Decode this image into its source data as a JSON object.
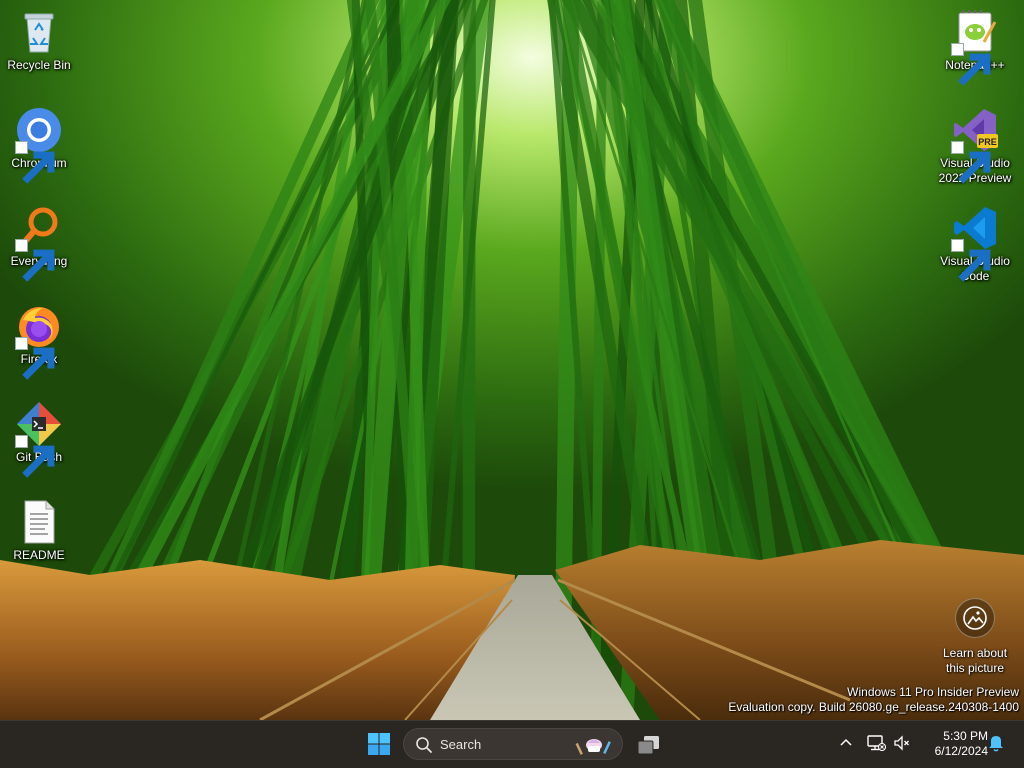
{
  "desktop": {
    "left_icons": [
      {
        "label": "Recycle Bin",
        "icon": "recycle-bin-icon"
      },
      {
        "label": "Chromium",
        "icon": "chromium-icon"
      },
      {
        "label": "Everything",
        "icon": "everything-search-icon"
      },
      {
        "label": "Firefox",
        "icon": "firefox-icon"
      },
      {
        "label": "Git Bash",
        "icon": "git-bash-icon"
      },
      {
        "label": "README",
        "icon": "text-document-icon"
      }
    ],
    "right_icons": [
      {
        "label": "Notepad++",
        "icon": "notepad-plus-plus-icon"
      },
      {
        "label": "Visual Studio 2022 Preview",
        "badge": "PRE",
        "icon": "visual-studio-preview-icon"
      },
      {
        "label": "Visual Studio Code",
        "icon": "vscode-icon"
      }
    ],
    "learn_about": {
      "label": "Learn about this picture",
      "icon": "camera-info-icon"
    },
    "watermark": {
      "line1": "Windows 11 Pro Insider Preview",
      "line2": "Evaluation copy. Build 26080.ge_release.240308-1400"
    }
  },
  "taskbar": {
    "start_icon": "windows-logo-icon",
    "search": {
      "placeholder": "Search",
      "icon": "search-icon"
    },
    "task_view_icon": "task-view-icon",
    "tray": {
      "overflow_icon": "chevron-up-icon",
      "network_icon": "network-disconnected-icon",
      "volume_icon": "volume-muted-icon",
      "notification_icon": "bell-icon"
    },
    "clock": {
      "time": "5:30 PM",
      "date": "6/12/2024"
    }
  },
  "colors": {
    "taskbar_bg": "#2a2622",
    "accent": "#0078d4",
    "vs_purple": "#8661c5",
    "vscode_blue": "#0b7ad1"
  }
}
